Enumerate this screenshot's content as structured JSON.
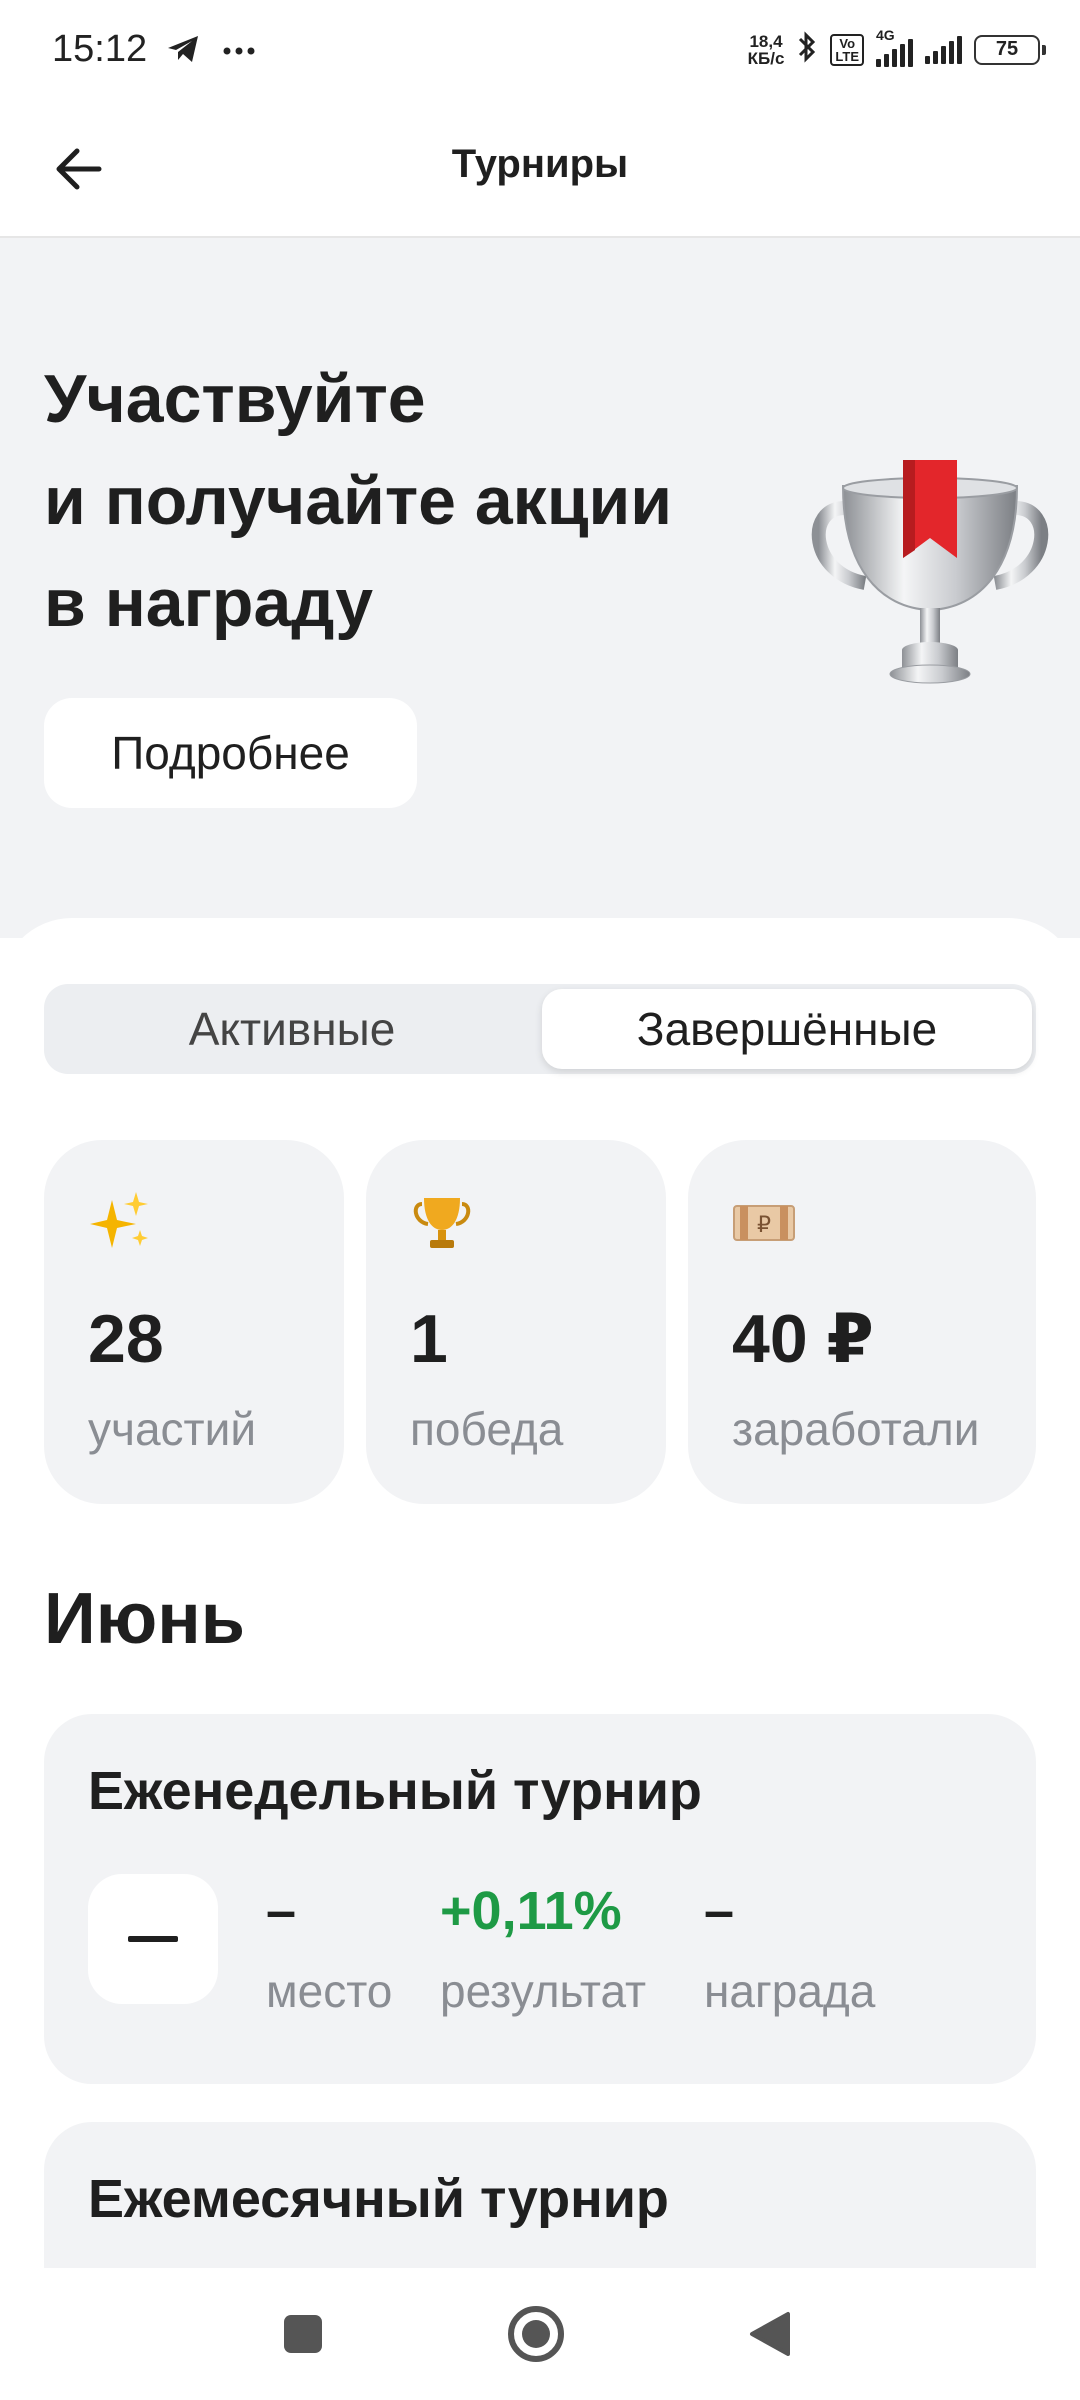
{
  "status_bar": {
    "time": "15:12",
    "left_icons": [
      "telegram-icon",
      "more-dots-icon"
    ],
    "net_speed_value": "18,4",
    "net_speed_unit": "КБ/с",
    "volte_top": "Vo",
    "volte_bottom": "LTE",
    "network_label": "4G",
    "battery": "75"
  },
  "app_bar": {
    "title": "Турниры",
    "back_icon": "arrow-left-icon"
  },
  "hero": {
    "title_lines": [
      "Участвуйте",
      "и получайте акции",
      "в награду"
    ],
    "more_button": "Подробнее",
    "illustration": "trophy-cup-with-red-ribbon",
    "background": "#f2f3f5"
  },
  "tabs": {
    "active": "Активные",
    "finished": "Завершённые",
    "selected": "finished"
  },
  "stats": [
    {
      "icon": "sparkles-icon",
      "value": "28",
      "label": "участий"
    },
    {
      "icon": "trophy-icon",
      "value": "1",
      "label": "победа"
    },
    {
      "icon": "ruble-banknote-icon",
      "value": "40 ₽",
      "label": "заработали"
    }
  ],
  "month": "Июнь",
  "tournaments": [
    {
      "title": "Еженедельный турнир",
      "place_value": "–",
      "place_label": "место",
      "result_value": "+0,11%",
      "result_label": "результат",
      "reward_value": "–",
      "reward_label": "награда"
    },
    {
      "title": "Ежемесячный турнир"
    }
  ],
  "nav_bar": {
    "buttons": [
      "recents-square-icon",
      "home-circle-icon",
      "back-triangle-icon"
    ]
  },
  "colors": {
    "accent_positive": "#1e9a45",
    "card_bg": "#f2f3f5",
    "muted_text": "#8a8d93"
  }
}
